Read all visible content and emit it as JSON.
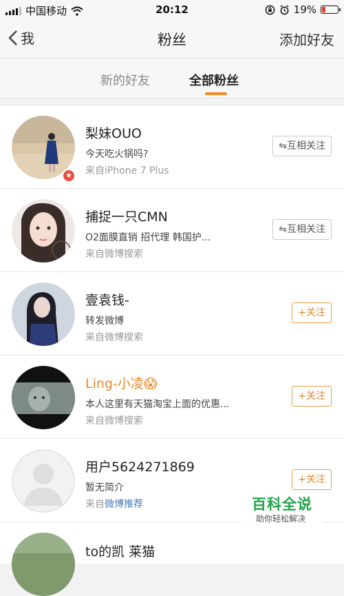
{
  "status_bar": {
    "carrier": "中国移动",
    "time": "20:12",
    "battery": "19%",
    "battery_level": 0.19,
    "battery_color": "#e53a2f"
  },
  "nav": {
    "back_label": "我",
    "title": "粉丝",
    "action_label": "添加好友"
  },
  "tabs": [
    {
      "label": "新的好友",
      "active": false
    },
    {
      "label": "全部粉丝",
      "active": true
    }
  ],
  "accent_color": "#f08a24",
  "followers": [
    {
      "name": "梨妹OUO",
      "bio": "今天吃火锅吗?",
      "source": "来自iPhone 7 Plus",
      "button": "⇋互相关注"
    },
    {
      "name": "捕捉一只CMN",
      "bio": "O2面膜直销 招代理 韩国护...",
      "source": "来自微博搜索",
      "button": "⇋互相关注"
    },
    {
      "name": "壹袁钱-",
      "bio": "转发微博",
      "source": "来自微博搜索",
      "button": "+关注"
    },
    {
      "name": "Ling-小凌😱",
      "bio": "本人这里有天猫淘宝上面的优惠...",
      "source": "来自微博搜索",
      "button": "+关注"
    },
    {
      "name": "用户5624271869",
      "bio": "暂无简介",
      "source_prefix": "来自",
      "source_link": "微博推荐",
      "button": "+关注"
    },
    {
      "name": "to的凯 莱猫"
    }
  ],
  "watermark": {
    "title": "百科全说",
    "subtitle": "助你轻松解决"
  }
}
